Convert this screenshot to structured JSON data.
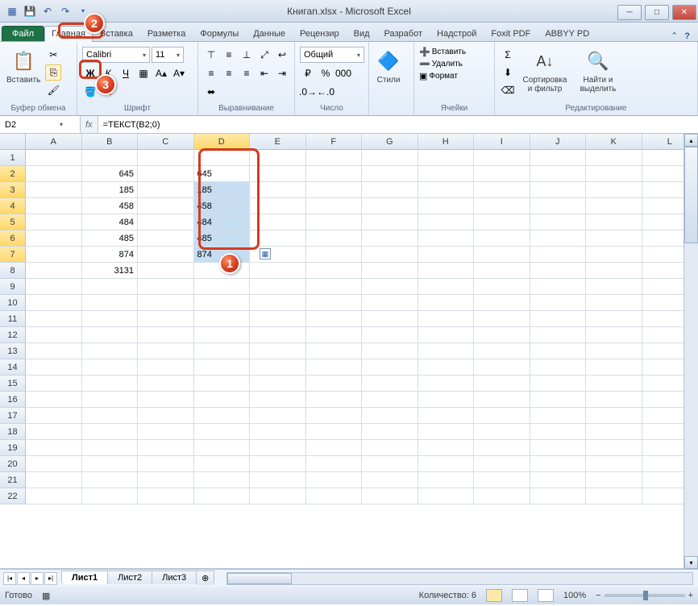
{
  "title": "Книгаn.xlsx - Microsoft Excel",
  "tabs": {
    "file": "Файл",
    "list": [
      "Главная",
      "Вставка",
      "Разметка",
      "Формулы",
      "Данные",
      "Рецензир",
      "Вид",
      "Разработ",
      "Надстрой",
      "Foxit PDF",
      "ABBYY PD"
    ],
    "active_index": 0
  },
  "ribbon": {
    "clipboard": {
      "paste": "Вставить",
      "label": "Буфер обмена"
    },
    "font": {
      "name": "Calibri",
      "size": "11",
      "label": "Шрифт"
    },
    "align": {
      "label": "Выравнивание"
    },
    "number": {
      "format": "Общий",
      "label": "Число"
    },
    "styles": {
      "btn": "Стили",
      "label": ""
    },
    "cells": {
      "insert": "Вставить",
      "delete": "Удалить",
      "format": "Формат",
      "label": "Ячейки"
    },
    "editing": {
      "sort": "Сортировка и фильтр",
      "find": "Найти и выделить",
      "label": "Редактирование"
    }
  },
  "namebox": "D2",
  "formula": "=ТЕКСТ(B2;0)",
  "columns": [
    "A",
    "B",
    "C",
    "D",
    "E",
    "F",
    "G",
    "H",
    "I",
    "J",
    "K",
    "L"
  ],
  "sel_col_index": 3,
  "rows": 22,
  "sel_rows": [
    2,
    3,
    4,
    5,
    6,
    7
  ],
  "data_b": {
    "2": "645",
    "3": "185",
    "4": "458",
    "5": "484",
    "6": "485",
    "7": "874",
    "8": "3131"
  },
  "data_d": {
    "2": "645",
    "3": "185",
    "4": "458",
    "5": "484",
    "6": "485",
    "7": "874"
  },
  "sheets": [
    "Лист1",
    "Лист2",
    "Лист3"
  ],
  "active_sheet": 0,
  "status": {
    "ready": "Готово",
    "count_label": "Количество: 6",
    "zoom": "100%"
  },
  "badges": {
    "sel": "1",
    "tab": "2",
    "copy": "3"
  }
}
